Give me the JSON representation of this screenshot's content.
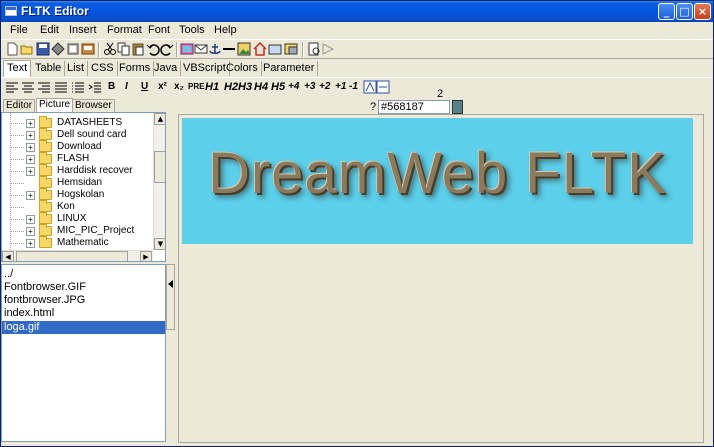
{
  "window": {
    "title": "FLTK Editor",
    "controls": {
      "minimize": "_",
      "maximize": "□",
      "close": "×"
    }
  },
  "menubar": [
    "File",
    "Edit",
    "Insert",
    "Format",
    "Font",
    "Tools",
    "Help"
  ],
  "toolbar_icons": [
    "new-icon",
    "open-icon",
    "save-icon",
    "print-icon",
    "preview-icon",
    "spell-icon",
    "cut-icon",
    "copy-icon",
    "paste-icon",
    "undo-icon",
    "redo-icon",
    "image-icon",
    "email-icon",
    "anchor-icon",
    "hr-icon",
    "picture-icon",
    "home-icon",
    "browse-icon",
    "publish-icon",
    "find-icon",
    "arrow-icon"
  ],
  "tabs": [
    "Text",
    "Table",
    "List",
    "CSS",
    "Forms",
    "Java",
    "VBScript",
    "Colors",
    "Parameter"
  ],
  "format_bar": {
    "bold": "B",
    "italic": "I",
    "underline": "U",
    "superscript": "x²",
    "subscript": "x₂",
    "pre": "PRE",
    "headings": [
      "H1",
      "H2",
      "H3",
      "H4",
      "H5"
    ],
    "sizes": [
      "+4",
      "+3",
      "+2",
      "+1",
      "-1"
    ]
  },
  "left_tabs": [
    "Editor",
    "Picture",
    "Browser"
  ],
  "color": {
    "label": "?",
    "value": "#568187",
    "counter": "2",
    "swatch": "#568187"
  },
  "tree": [
    "DATASHEETS",
    "Dell sound card",
    "Download",
    "FLASH",
    "Harddisk recover",
    "Hemsidan",
    "Hogskolan",
    "Kon",
    "LINUX",
    "MIC_PIC_Project",
    "Mathematic"
  ],
  "files": [
    "../",
    "Fontbrowser.GIF",
    "fontbrowser.JPG",
    "index.html",
    "loga.gif"
  ],
  "selected_file": "loga.gif",
  "banner": {
    "text": "DreamWeb FLTK",
    "bg": "#5ccfea"
  }
}
